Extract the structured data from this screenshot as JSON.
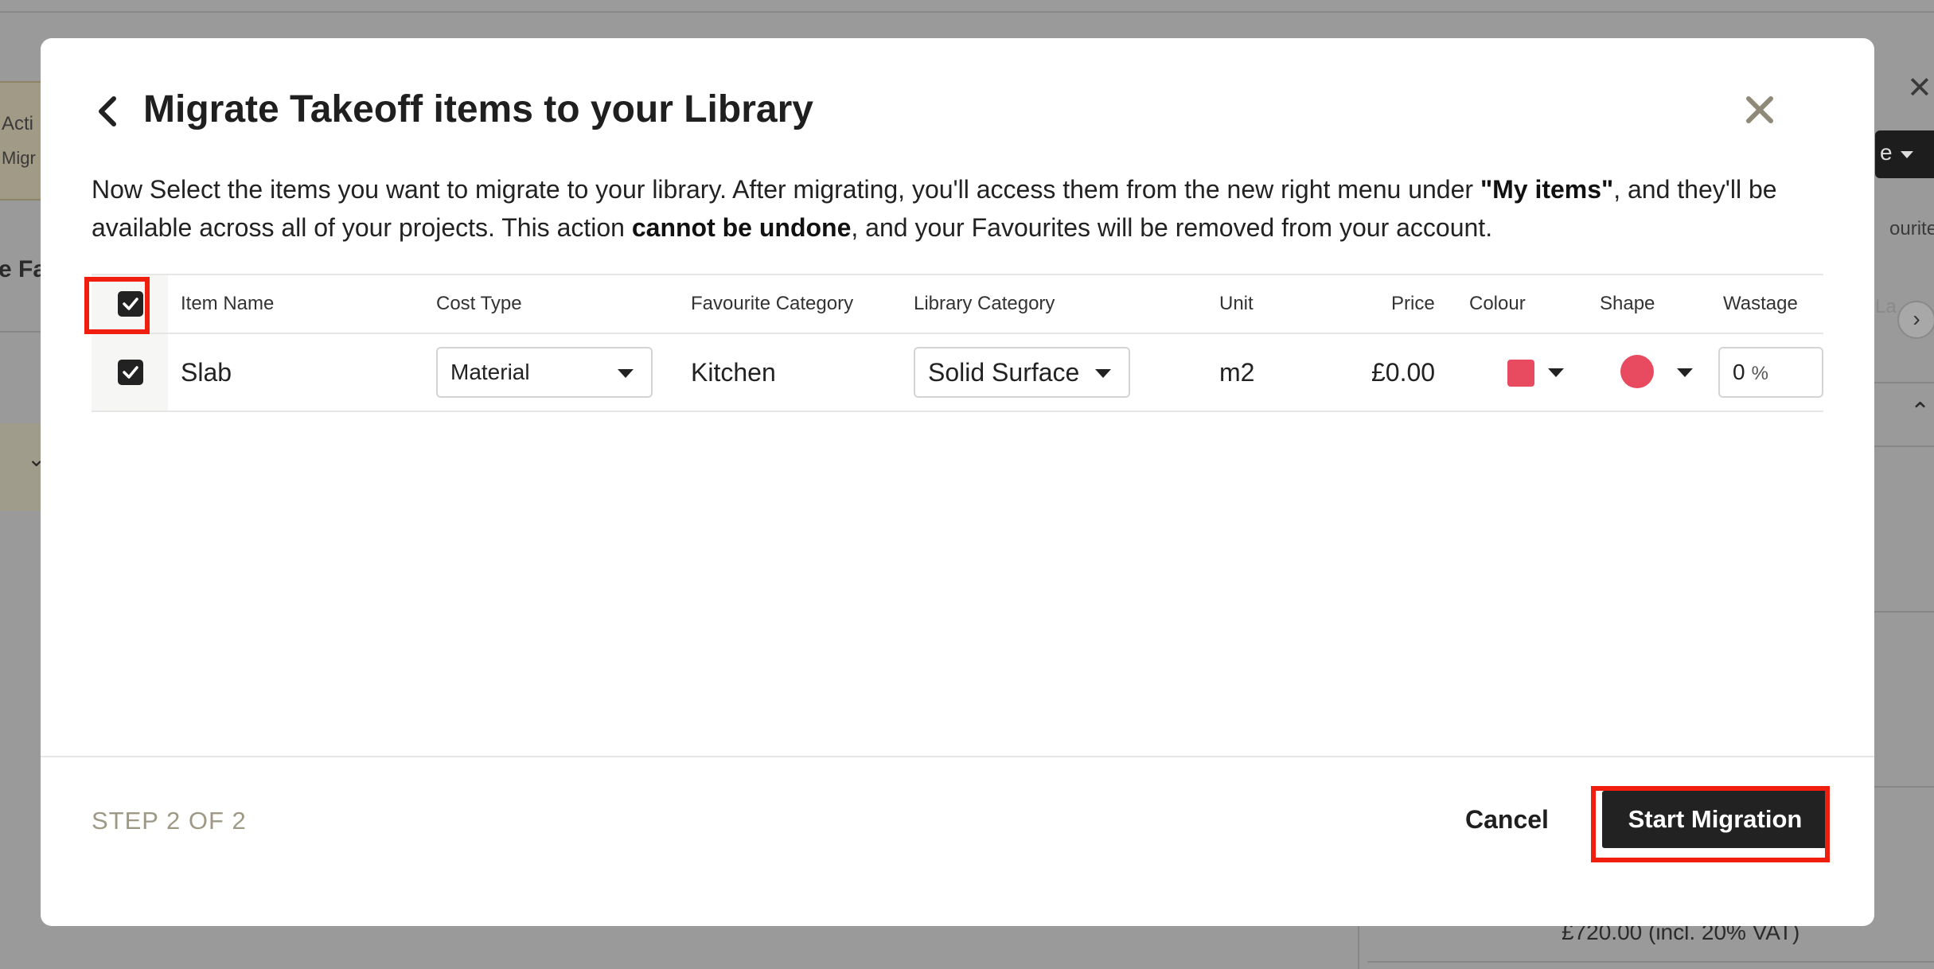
{
  "background": {
    "left_card_line1": "Acti",
    "left_card_line2": "Migr",
    "left_heading": "e Fa",
    "right_btn_text": "e",
    "right_text_favourites": "ourites",
    "right_tab_text": "La",
    "vat_text": "£720.00 (incl. 20% VAT)"
  },
  "modal": {
    "title": "Migrate Takeoff items to your Library",
    "description": {
      "part1": "Now Select the items you want to migrate to your library. After migrating, you'll access them from the new right menu under ",
      "bold1": "\"My items\"",
      "part2": ", and they'll be available across all of your projects. This action ",
      "bold2": "cannot be undone",
      "part3": ", and your Favourites will be removed from your account."
    },
    "table": {
      "headers": {
        "item_name": "Item Name",
        "cost_type": "Cost Type",
        "favourite_category": "Favourite Category",
        "library_category": "Library Category",
        "unit": "Unit",
        "price": "Price",
        "colour": "Colour",
        "shape": "Shape",
        "wastage": "Wastage"
      },
      "select_all_checked": true,
      "rows": [
        {
          "checked": true,
          "item_name": "Slab",
          "cost_type": "Material",
          "favourite_category": "Kitchen",
          "library_category": "Solid Surface",
          "unit": "m2",
          "price": "£0.00",
          "colour": "#e84a5f",
          "shape": "circle",
          "wastage_value": "0",
          "wastage_unit": "%"
        }
      ]
    },
    "footer": {
      "step": "STEP 2 OF 2",
      "cancel_label": "Cancel",
      "start_label": "Start Migration"
    }
  },
  "colors": {
    "highlight": "#f01e0e",
    "primary_button": "#222222",
    "swatch": "#e84a5f"
  }
}
